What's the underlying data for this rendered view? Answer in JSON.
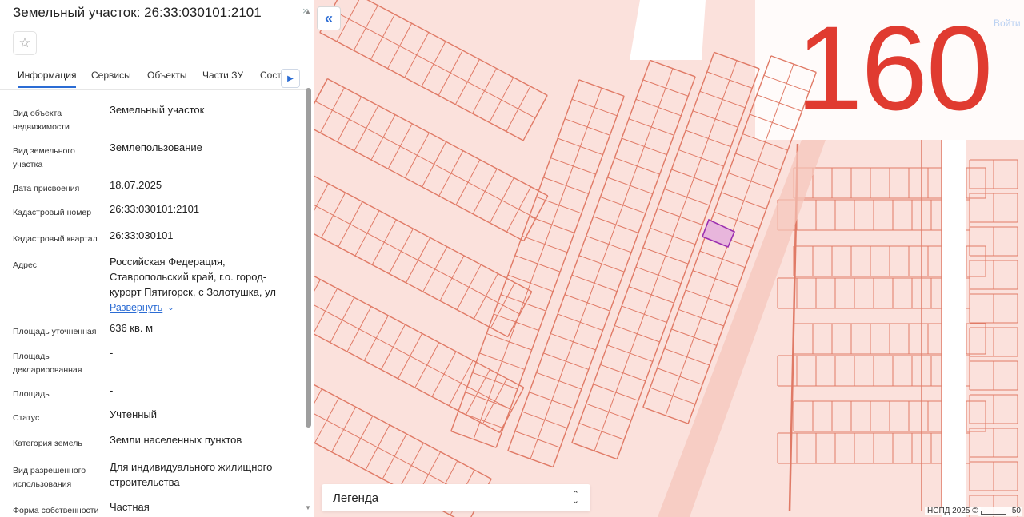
{
  "panel": {
    "title": "Земельный участок: 26:33:030101:2101",
    "close_glyph": "×",
    "favorite_icon": "star-outline-icon",
    "tabs": [
      {
        "label": "Информация",
        "active": true
      },
      {
        "label": "Сервисы",
        "active": false
      },
      {
        "label": "Объекты",
        "active": false
      },
      {
        "label": "Части ЗУ",
        "active": false
      },
      {
        "label": "Состав ЗУ",
        "active": false
      }
    ],
    "rows": [
      {
        "label": "Вид объекта недвижимости",
        "value": "Земельный участок"
      },
      {
        "label": "Вид земельного участка",
        "value": "Землепользование"
      },
      {
        "label": "Дата присвоения",
        "value": "18.07.2025"
      },
      {
        "label": "Кадастровый номер",
        "value": "26:33:030101:2101"
      },
      {
        "label": "Кадастровый квартал",
        "value": "26:33:030101"
      },
      {
        "label": "Адрес",
        "value": "Российская Федерация, Ставропольский край, г.о. город-курорт Пятигорск, с Золотушка, ул"
      },
      {
        "label": "Площадь уточненная",
        "value": "636 кв. м"
      },
      {
        "label": "Площадь декларированная",
        "value": "-"
      },
      {
        "label": "Площадь",
        "value": "-"
      },
      {
        "label": "Статус",
        "value": "Учтенный"
      },
      {
        "label": "Категория земель",
        "value": "Земли населенных пунктов"
      },
      {
        "label": "Вид разрешенного использования",
        "value": "Для индивидуального жилищного строительства"
      },
      {
        "label": "Форма собственности",
        "value": "Частная"
      }
    ],
    "expand_label": "Развернуть"
  },
  "map": {
    "overlay_number": "160",
    "login_label": "Войти",
    "legend_title": "Легенда",
    "attribution": "НСПД 2025 ©",
    "scale_value": "50",
    "colors": {
      "map_bg": "#fbe1dc",
      "parcel_line": "#e07a66",
      "selected_fill": "#e8b6dc",
      "selected_stroke": "#9b2fb0",
      "overlay_text": "#e03b30"
    }
  }
}
